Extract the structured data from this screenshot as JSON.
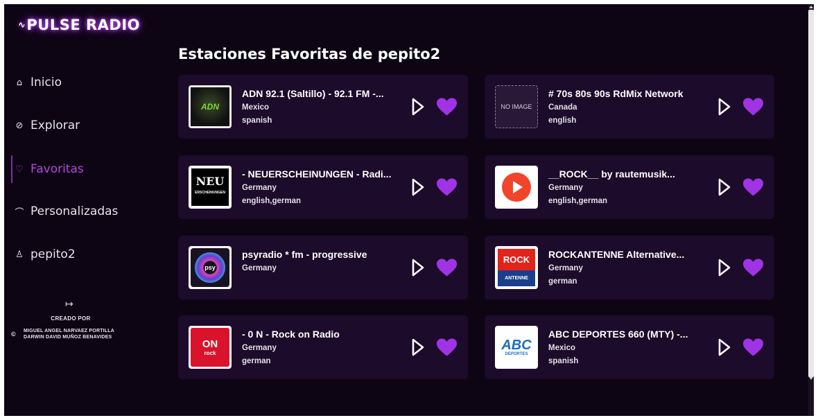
{
  "app": {
    "logo_pulse": "∿",
    "logo_text": "PULSE RADIO"
  },
  "sidebar": {
    "items": [
      {
        "label": "Inicio",
        "icon": "⌂"
      },
      {
        "label": "Explorar",
        "icon": "⊘"
      },
      {
        "label": "Favoritas",
        "icon": "♡"
      },
      {
        "label": "Personalizadas",
        "icon": "⌒"
      },
      {
        "label": "pepito2",
        "icon": "♙"
      }
    ],
    "logout_icon": "↦",
    "credit_title": "CREADO POR",
    "copyright": "©",
    "credit_line1": "MIGUEL ANGEL NARVAEZ PORTILLA",
    "credit_line2": "DARWIN DAVID MUÑOZ BENAVIDES"
  },
  "main": {
    "title": "Estaciones Favoritas de pepito2",
    "stations": [
      {
        "name": "ADN 92.1 (Saltillo) - 92.1 FM -...",
        "line2": "Mexico",
        "line3": "spanish",
        "thumb": "adn",
        "thumb_text": "ADN"
      },
      {
        "name": "# 70s 80s 90s RdMix Network",
        "line2": "Canada",
        "line3": "english",
        "thumb": "noimage",
        "thumb_text": "NO IMAGE"
      },
      {
        "name": "- NEUERSCHEINUNGEN - Radi...",
        "line2": "Germany",
        "line3": "english,german",
        "thumb": "neu",
        "thumb_text": "NEU"
      },
      {
        "name": "__ROCK__ by rautemusik...",
        "line2": "Germany",
        "line3": "english,german",
        "thumb": "play",
        "thumb_text": ""
      },
      {
        "name": "psyradio * fm - progressive",
        "line2": "Germany",
        "line3": "",
        "thumb": "psy",
        "thumb_text": "psy"
      },
      {
        "name": "ROCKANTENNE Alternative...",
        "line2": "Germany",
        "line3": "german",
        "thumb": "rockantenne",
        "thumb_text": "ROCK"
      },
      {
        "name": "- 0 N - Rock on Radio",
        "line2": "Germany",
        "line3": "german",
        "thumb": "on",
        "thumb_text": "ON"
      },
      {
        "name": "ABC DEPORTES 660 (MTY) -...",
        "line2": "Mexico",
        "line3": "spanish",
        "thumb": "abc",
        "thumb_text": "ABC"
      }
    ]
  },
  "colors": {
    "background": "#0d0514",
    "card": "#1c0b2a",
    "accent": "#a033e6",
    "active_nav": "#b04bd8"
  }
}
